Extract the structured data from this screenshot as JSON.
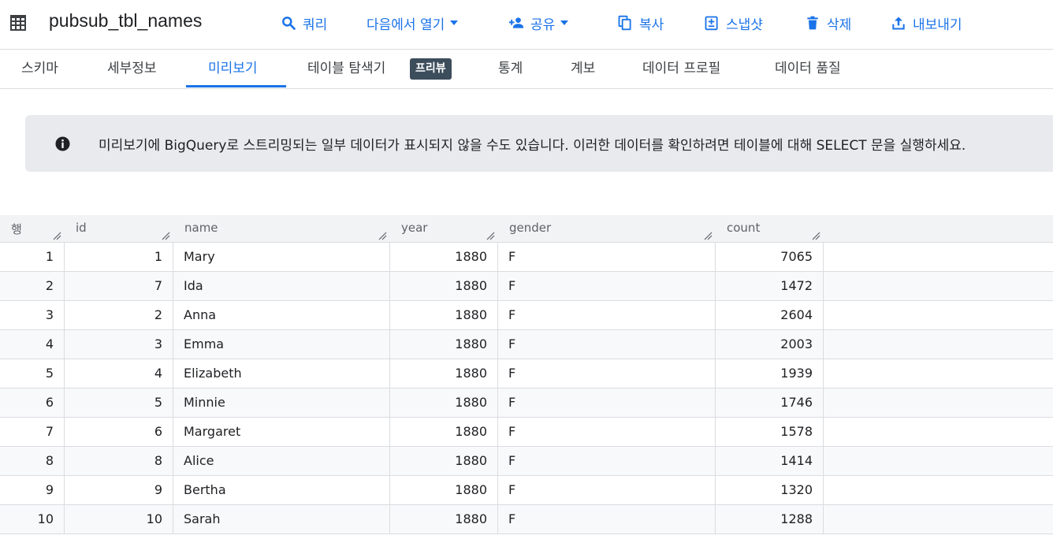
{
  "header": {
    "title": "pubsub_tbl_names",
    "actions": [
      {
        "label": "쿼리",
        "icon": "search-icon"
      },
      {
        "label": "다음에서 열기",
        "icon": "",
        "caret": true
      },
      {
        "label": "공유",
        "icon": "person-add-icon",
        "caret": true
      },
      {
        "label": "복사",
        "icon": "copy-icon"
      },
      {
        "label": "스냅샷",
        "icon": "snapshot-icon"
      },
      {
        "label": "삭제",
        "icon": "trash-icon"
      },
      {
        "label": "내보내기",
        "icon": "upload-icon"
      }
    ],
    "accent_color": "#1a73e8"
  },
  "tabs": [
    {
      "label": "스키마"
    },
    {
      "label": "세부정보"
    },
    {
      "label": "미리보기",
      "active": true
    },
    {
      "label": "테이블 탐색기",
      "badge": "프리뷰"
    },
    {
      "label": "통계"
    },
    {
      "label": "계보"
    },
    {
      "label": "데이터 프로필"
    },
    {
      "label": "데이터 품질"
    }
  ],
  "banner": {
    "icon": "info-icon",
    "text": "미리보기에 BigQuery로 스트리밍되는 일부 데이터가 표시되지 않을 수도 있습니다. 이러한 데이터를 확인하려면 테이블에 대해 SELECT 문을 실행하세요."
  },
  "table": {
    "columns": [
      "행",
      "id",
      "name",
      "year",
      "gender",
      "count"
    ],
    "rows": [
      {
        "row": "1",
        "id": "1",
        "name": "Mary",
        "year": "1880",
        "gender": "F",
        "count": "7065"
      },
      {
        "row": "2",
        "id": "7",
        "name": "Ida",
        "year": "1880",
        "gender": "F",
        "count": "1472"
      },
      {
        "row": "3",
        "id": "2",
        "name": "Anna",
        "year": "1880",
        "gender": "F",
        "count": "2604"
      },
      {
        "row": "4",
        "id": "3",
        "name": "Emma",
        "year": "1880",
        "gender": "F",
        "count": "2003"
      },
      {
        "row": "5",
        "id": "4",
        "name": "Elizabeth",
        "year": "1880",
        "gender": "F",
        "count": "1939"
      },
      {
        "row": "6",
        "id": "5",
        "name": "Minnie",
        "year": "1880",
        "gender": "F",
        "count": "1746"
      },
      {
        "row": "7",
        "id": "6",
        "name": "Margaret",
        "year": "1880",
        "gender": "F",
        "count": "1578"
      },
      {
        "row": "8",
        "id": "8",
        "name": "Alice",
        "year": "1880",
        "gender": "F",
        "count": "1414"
      },
      {
        "row": "9",
        "id": "9",
        "name": "Bertha",
        "year": "1880",
        "gender": "F",
        "count": "1320"
      },
      {
        "row": "10",
        "id": "10",
        "name": "Sarah",
        "year": "1880",
        "gender": "F",
        "count": "1288"
      }
    ]
  }
}
